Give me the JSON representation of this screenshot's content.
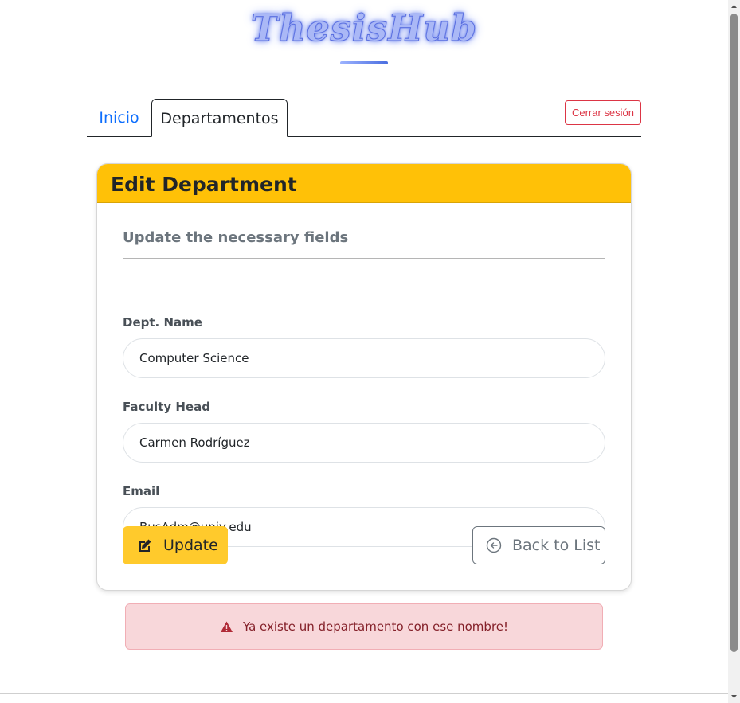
{
  "brand": {
    "logo_text": "ThesisHub"
  },
  "nav": {
    "tabs": [
      {
        "label": "Inicio",
        "active": false
      },
      {
        "label": "Departamentos",
        "active": true
      }
    ],
    "logout_label": "Cerrar sesión"
  },
  "card": {
    "title": "Edit Department",
    "subtitle": "Update the necessary fields",
    "fields": [
      {
        "label": "Dept. Name",
        "value": "Computer Science"
      },
      {
        "label": "Faculty Head",
        "value": "Carmen Rodríguez"
      },
      {
        "label": "Email",
        "value": "BusAdm@univ.edu"
      }
    ],
    "update_label": "Update",
    "back_label": "Back to List",
    "update_icon": "edit-icon",
    "back_icon": "arrow-left-circle-icon"
  },
  "alert": {
    "message": "Ya existe un departamento con ese nombre!",
    "icon": "warning-triangle-icon"
  },
  "colors": {
    "header_accent": "#ffc107",
    "update_button": "#ffca2c",
    "link_blue": "#0d6efd",
    "danger": "#dc3545",
    "alert_bg": "#f8d7da",
    "alert_text": "#842029"
  }
}
